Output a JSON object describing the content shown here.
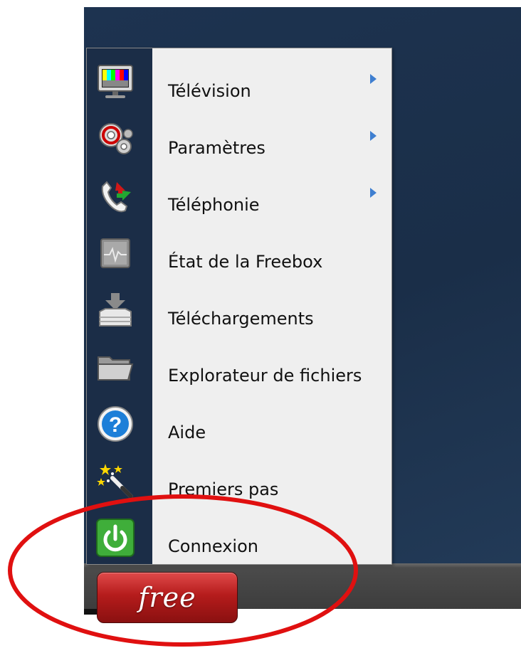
{
  "start_button": {
    "label": "free"
  },
  "menu": {
    "items": [
      {
        "label": "Télévision",
        "icon": "tv-icon",
        "has_submenu": true
      },
      {
        "label": "Paramètres",
        "icon": "gears-icon",
        "has_submenu": true
      },
      {
        "label": "Téléphonie",
        "icon": "phone-icon",
        "has_submenu": true
      },
      {
        "label": "État de la Freebox",
        "icon": "monitor-pulse-icon",
        "has_submenu": false
      },
      {
        "label": "Téléchargements",
        "icon": "download-tray-icon",
        "has_submenu": false
      },
      {
        "label": "Explorateur de fichiers",
        "icon": "folder-icon",
        "has_submenu": false
      },
      {
        "label": "Aide",
        "icon": "help-icon",
        "has_submenu": false
      },
      {
        "label": "Premiers pas",
        "icon": "magic-wand-icon",
        "has_submenu": false
      },
      {
        "label": "Connexion",
        "icon": "power-icon",
        "has_submenu": false
      }
    ]
  },
  "colors": {
    "menu_background": "#efefef",
    "menu_icon_column": "#1b2d47",
    "desktop": "#1d3350",
    "taskbar": "#4b4b4b",
    "start_button": "#b51c1c",
    "highlight_ellipse": "#e01010",
    "submenu_arrow": "#3f7fd0"
  }
}
